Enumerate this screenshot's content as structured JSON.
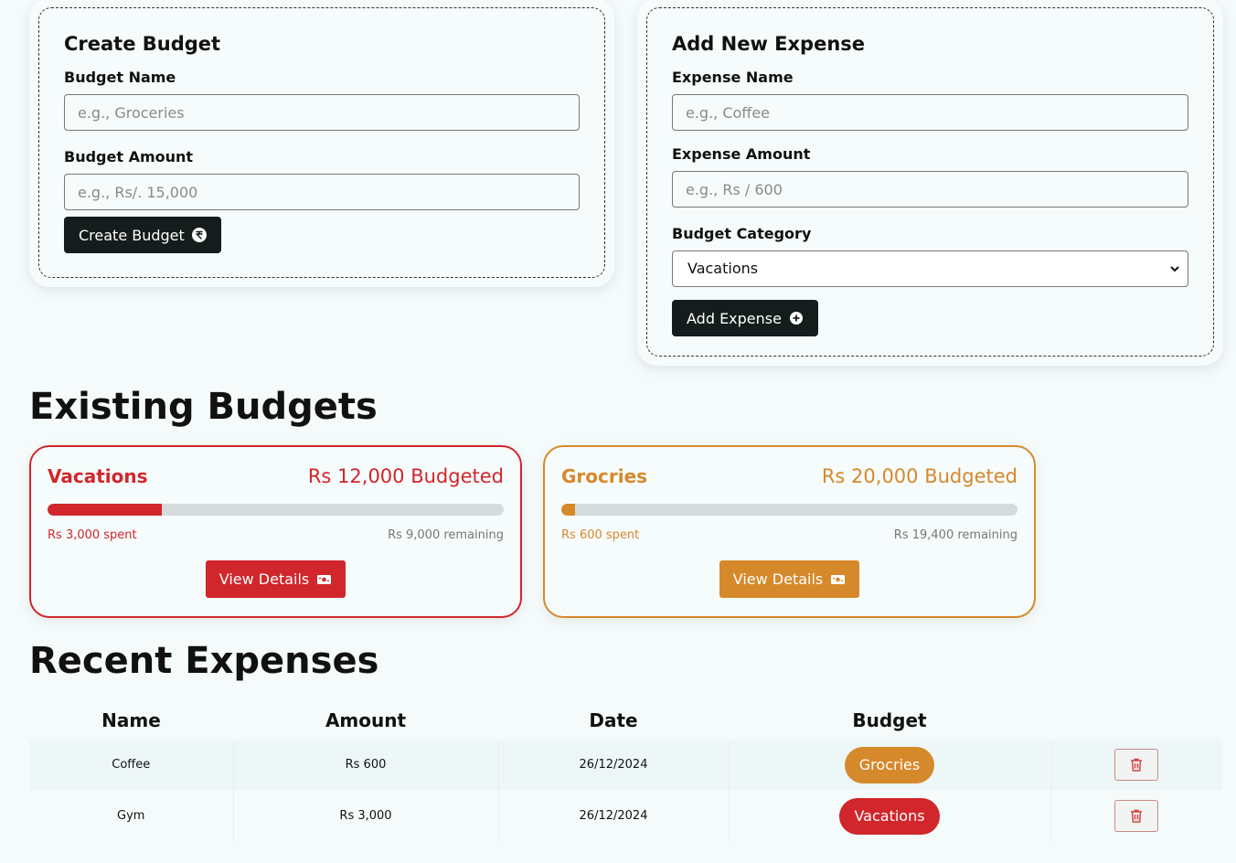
{
  "create_budget": {
    "title": "Create Budget",
    "name_label": "Budget Name",
    "name_placeholder": "e.g., Groceries",
    "amount_label": "Budget Amount",
    "amount_placeholder": "e.g., Rs/. 15,000",
    "button_label": "Create Budget",
    "button_icon": "currency-circle-icon"
  },
  "add_expense": {
    "title": "Add New Expense",
    "name_label": "Expense Name",
    "name_placeholder": "e.g., Coffee",
    "amount_label": "Expense Amount",
    "amount_placeholder": "e.g., Rs / 600",
    "category_label": "Budget Category",
    "category_selected": "Vacations",
    "button_label": "Add Expense",
    "button_icon": "plus-circle-icon"
  },
  "existing_budgets": {
    "title": "Existing Budgets",
    "items": [
      {
        "name": "Vacations",
        "budgeted": "Rs 12,000 Budgeted",
        "spent": "Rs 3,000 spent",
        "remaining": "Rs 9,000 remaining",
        "progress": 0.25,
        "color": "#d1262b",
        "button_label": "View Details",
        "button_icon": "cash-icon"
      },
      {
        "name": "Grocries",
        "budgeted": "Rs 20,000 Budgeted",
        "spent": "Rs 600 spent",
        "remaining": "Rs 19,400 remaining",
        "progress": 0.03,
        "color": "#d6892b",
        "button_label": "View Details",
        "button_icon": "cash-icon"
      }
    ]
  },
  "recent_expenses": {
    "title": "Recent Expenses",
    "columns": [
      "Name",
      "Amount",
      "Date",
      "Budget"
    ],
    "rows": [
      {
        "name": "Coffee",
        "amount": "Rs 600",
        "date": "26/12/2024",
        "budget": "Grocries",
        "budget_color": "#d6892b"
      },
      {
        "name": "Gym",
        "amount": "Rs 3,000",
        "date": "26/12/2024",
        "budget": "Vacations",
        "budget_color": "#d1262b"
      }
    ],
    "delete_icon": "trash-icon"
  },
  "colors": {
    "dark_button": "#141c1c",
    "background": "#f5fbfb",
    "delete_icon": "#d64545"
  }
}
